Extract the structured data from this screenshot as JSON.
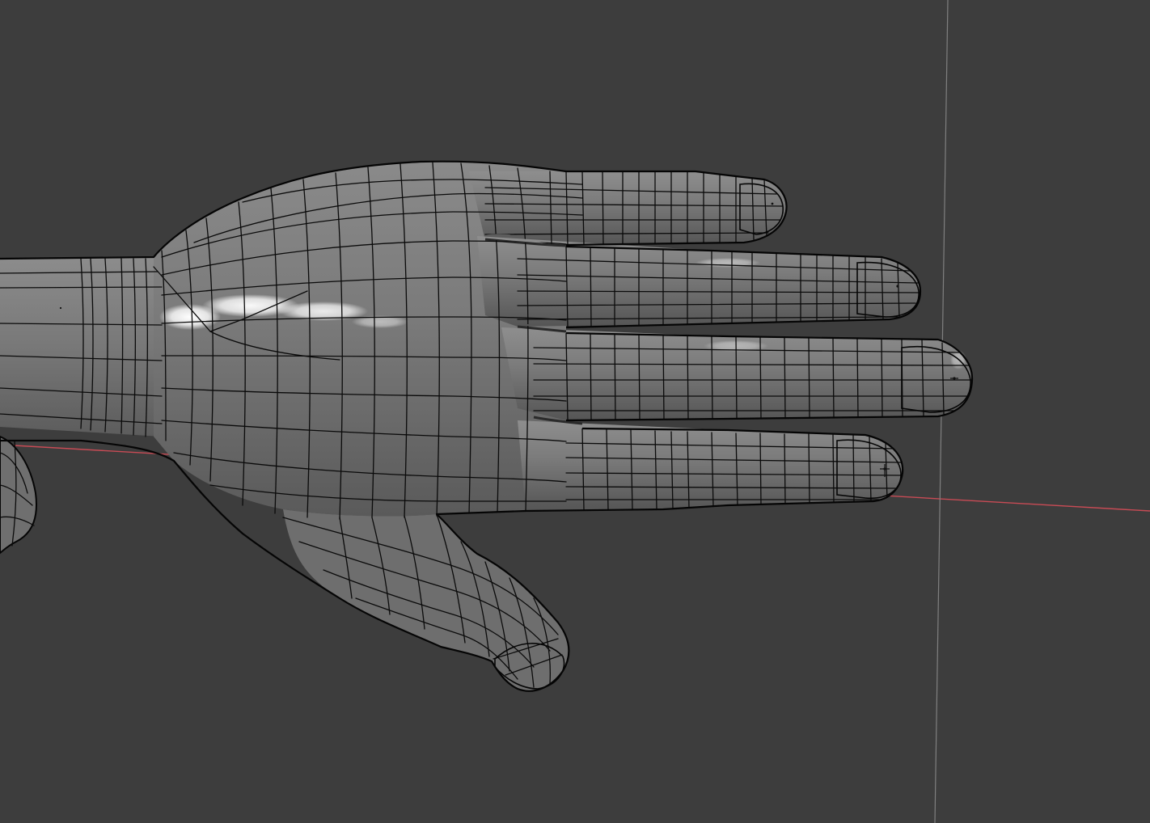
{
  "viewport": {
    "background_color": "#3d3d3d",
    "mesh_base_color": "#7f7f7f",
    "mesh_shadow_color": "#4f4f4f",
    "wireframe_color": "#0a0a0a",
    "x_axis_color": "#d0505a",
    "z_axis_color": "#888888"
  },
  "scene": {
    "object": "hand-mesh",
    "shading": "solid",
    "overlay": "wireframe",
    "fingers": [
      "thumb",
      "index",
      "middle",
      "ring",
      "pinky"
    ]
  }
}
